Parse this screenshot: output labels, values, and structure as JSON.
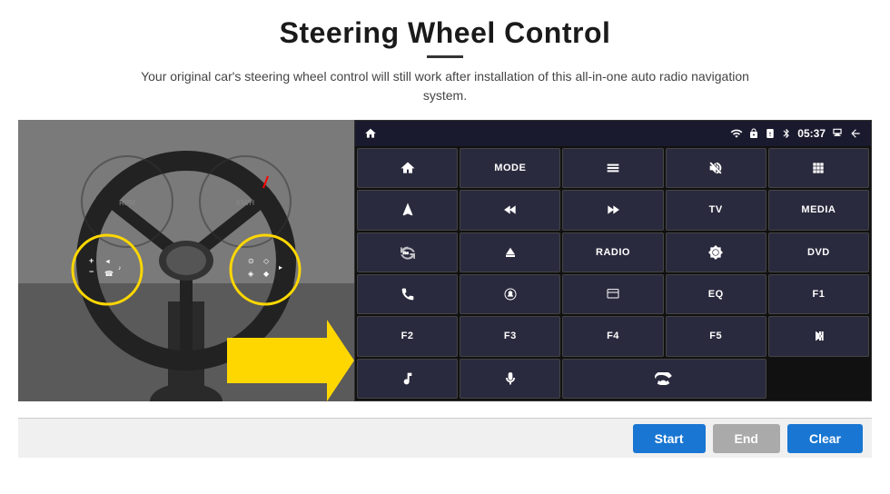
{
  "page": {
    "title": "Steering Wheel Control",
    "subtitle": "Your original car's steering wheel control will still work after installation of this all-in-one auto radio navigation system."
  },
  "status_bar": {
    "time": "05:37",
    "icons": [
      "wifi",
      "lock",
      "sim",
      "bluetooth",
      "battery",
      "screen",
      "back"
    ]
  },
  "controls": [
    {
      "id": "home",
      "type": "icon",
      "icon": "home"
    },
    {
      "id": "mode",
      "type": "text",
      "label": "MODE"
    },
    {
      "id": "list",
      "type": "icon",
      "icon": "list"
    },
    {
      "id": "mute",
      "type": "icon",
      "icon": "mute"
    },
    {
      "id": "apps",
      "type": "icon",
      "icon": "apps"
    },
    {
      "id": "nav",
      "type": "icon",
      "icon": "navigate"
    },
    {
      "id": "rewind",
      "type": "icon",
      "icon": "rewind"
    },
    {
      "id": "forward",
      "type": "icon",
      "icon": "forward"
    },
    {
      "id": "tv",
      "type": "text",
      "label": "TV"
    },
    {
      "id": "media",
      "type": "text",
      "label": "MEDIA"
    },
    {
      "id": "360",
      "type": "icon",
      "icon": "360cam"
    },
    {
      "id": "eject",
      "type": "icon",
      "icon": "eject"
    },
    {
      "id": "radio",
      "type": "text",
      "label": "RADIO"
    },
    {
      "id": "brightness",
      "type": "icon",
      "icon": "brightness"
    },
    {
      "id": "dvd",
      "type": "text",
      "label": "DVD"
    },
    {
      "id": "phone",
      "type": "icon",
      "icon": "phone"
    },
    {
      "id": "waze",
      "type": "icon",
      "icon": "waze"
    },
    {
      "id": "window",
      "type": "icon",
      "icon": "window"
    },
    {
      "id": "eq",
      "type": "text",
      "label": "EQ"
    },
    {
      "id": "f1",
      "type": "text",
      "label": "F1"
    },
    {
      "id": "f2",
      "type": "text",
      "label": "F2"
    },
    {
      "id": "f3",
      "type": "text",
      "label": "F3"
    },
    {
      "id": "f4",
      "type": "text",
      "label": "F4"
    },
    {
      "id": "f5",
      "type": "text",
      "label": "F5"
    },
    {
      "id": "playpause",
      "type": "icon",
      "icon": "playpause"
    },
    {
      "id": "music",
      "type": "icon",
      "icon": "music"
    },
    {
      "id": "mic",
      "type": "icon",
      "icon": "mic"
    },
    {
      "id": "hangup",
      "type": "icon",
      "icon": "hangup"
    }
  ],
  "bottom_bar": {
    "start_label": "Start",
    "end_label": "End",
    "clear_label": "Clear"
  }
}
